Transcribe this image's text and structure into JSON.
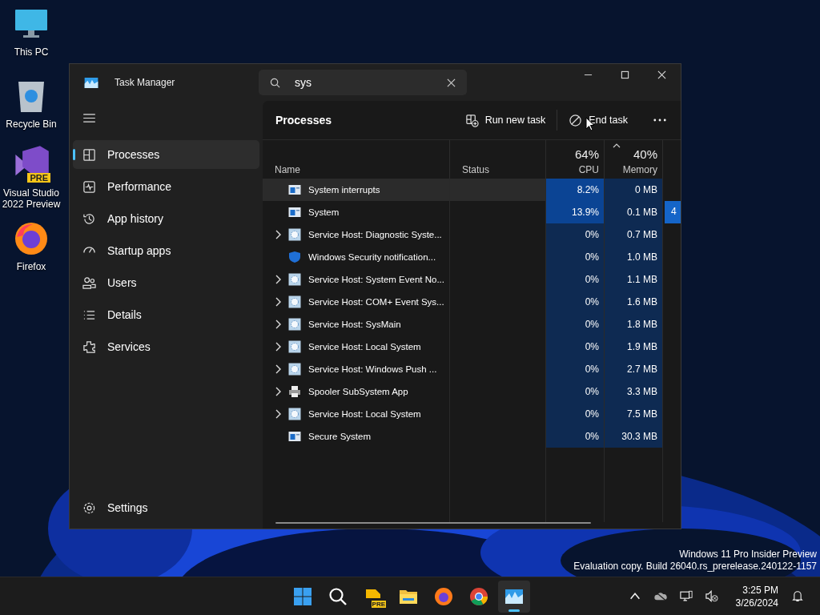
{
  "desktop_icons": [
    {
      "label": "This PC",
      "kind": "monitor"
    },
    {
      "label": "Recycle Bin",
      "kind": "bin"
    },
    {
      "label": "Visual Studio 2022 Preview",
      "kind": "vs",
      "badge": "PRE"
    },
    {
      "label": "Firefox",
      "kind": "firefox"
    }
  ],
  "window": {
    "title": "Task Manager",
    "search": {
      "value": "sys"
    }
  },
  "sidebar": {
    "items": [
      {
        "label": "Processes",
        "kind": "processes",
        "selected": true
      },
      {
        "label": "Performance",
        "kind": "performance",
        "selected": false
      },
      {
        "label": "App history",
        "kind": "history",
        "selected": false
      },
      {
        "label": "Startup apps",
        "kind": "startup",
        "selected": false
      },
      {
        "label": "Users",
        "kind": "users",
        "selected": false
      },
      {
        "label": "Details",
        "kind": "details",
        "selected": false
      },
      {
        "label": "Services",
        "kind": "services",
        "selected": false
      }
    ],
    "settings": "Settings"
  },
  "toolbar": {
    "title": "Processes",
    "buttons": [
      {
        "label": "Run new task",
        "kind": "run"
      },
      {
        "label": "End task",
        "kind": "end"
      }
    ]
  },
  "table": {
    "columns": [
      {
        "label": "Name"
      },
      {
        "label": "Status"
      },
      {
        "label": "CPU",
        "usage": "64%"
      },
      {
        "label": "Memory",
        "usage": "40%"
      }
    ],
    "rows": [
      {
        "name": "System interrupts",
        "kind": "system",
        "expandable": false,
        "selected": true,
        "cpu": {
          "value": "8.2%",
          "color": "#0b4494"
        },
        "memory": "0 MB"
      },
      {
        "name": "System",
        "kind": "system",
        "expandable": false,
        "selected": false,
        "cpu": {
          "value": "13.9%",
          "color": "#0b4494"
        },
        "memory": "0.1 MB",
        "column_5": "4"
      },
      {
        "name": "Service Host: Diagnostic Syste...",
        "kind": "gear",
        "expandable": true,
        "selected": false,
        "cpu": {
          "value": "0%",
          "color": "#0e2a52"
        },
        "memory": "0.7 MB"
      },
      {
        "name": "Windows Security notification...",
        "kind": "shield",
        "expandable": false,
        "selected": false,
        "cpu": {
          "value": "0%",
          "color": "#0e2a52"
        },
        "memory": "1.0 MB"
      },
      {
        "name": "Service Host: System Event No...",
        "kind": "gear",
        "expandable": true,
        "selected": false,
        "cpu": {
          "value": "0%",
          "color": "#0e2a52"
        },
        "memory": "1.1 MB"
      },
      {
        "name": "Service Host: COM+ Event Sys...",
        "kind": "gear",
        "expandable": true,
        "selected": false,
        "cpu": {
          "value": "0%",
          "color": "#0e2a52"
        },
        "memory": "1.6 MB"
      },
      {
        "name": "Service Host: SysMain",
        "kind": "gear",
        "expandable": true,
        "selected": false,
        "cpu": {
          "value": "0%",
          "color": "#0e2a52"
        },
        "memory": "1.8 MB"
      },
      {
        "name": "Service Host: Local System",
        "kind": "gear",
        "expandable": true,
        "selected": false,
        "cpu": {
          "value": "0%",
          "color": "#0e2a52"
        },
        "memory": "1.9 MB"
      },
      {
        "name": "Service Host: Windows Push ...",
        "kind": "gear",
        "expandable": true,
        "selected": false,
        "cpu": {
          "value": "0%",
          "color": "#0e2a52"
        },
        "memory": "2.7 MB"
      },
      {
        "name": "Spooler SubSystem App",
        "kind": "printer",
        "expandable": true,
        "selected": false,
        "cpu": {
          "value": "0%",
          "color": "#0e2a52"
        },
        "memory": "3.3 MB"
      },
      {
        "name": "Service Host: Local System",
        "kind": "gear",
        "expandable": true,
        "selected": false,
        "cpu": {
          "value": "0%",
          "color": "#0e2a52"
        },
        "memory": "7.5 MB"
      },
      {
        "name": "Secure System",
        "kind": "system",
        "expandable": false,
        "selected": false,
        "cpu": {
          "value": "0%",
          "color": "#0e2a52"
        },
        "memory": "30.3 MB"
      }
    ]
  },
  "watermark": [
    "Windows 11 Pro Insider Preview",
    "Evaluation copy. Build 26040.rs_prerelease.240122-1157"
  ],
  "taskbar": {
    "apps": [
      {
        "kind": "start",
        "active": false
      },
      {
        "kind": "search",
        "active": false
      },
      {
        "kind": "devhome",
        "badge": "PRE",
        "active": false
      },
      {
        "kind": "explorer",
        "active": false
      },
      {
        "kind": "firefox",
        "active": false
      },
      {
        "kind": "chrome",
        "active": false
      },
      {
        "kind": "taskmgr",
        "active": true
      }
    ],
    "time": "3:25 PM",
    "date": "3/26/2024"
  }
}
